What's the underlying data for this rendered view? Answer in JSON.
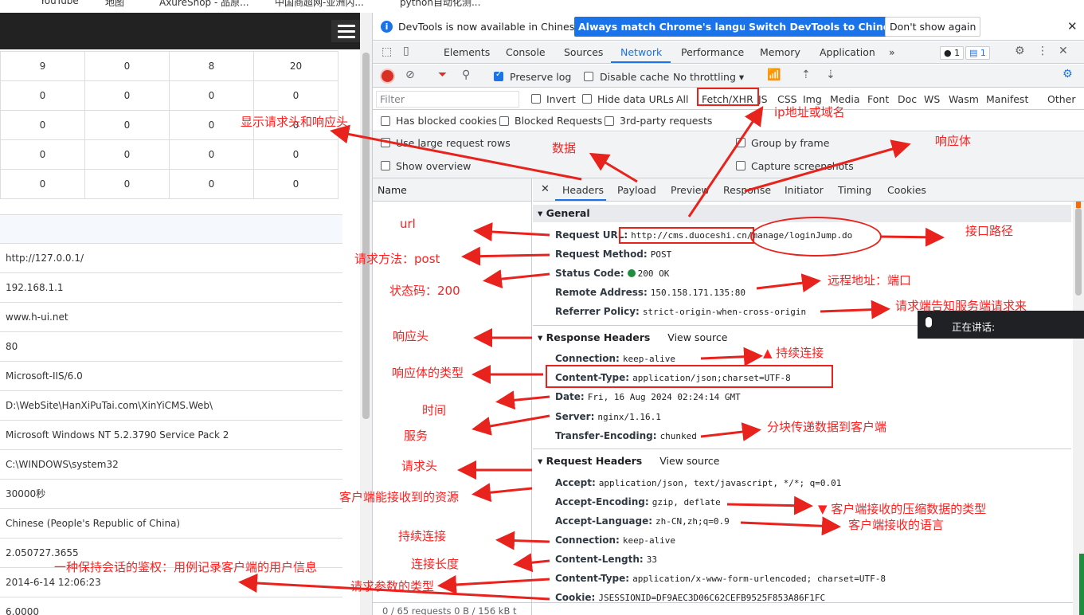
{
  "bookmarks": [
    "YouTube",
    "地图",
    "AxureShop - 品原...",
    "中国商超网-亚洲内...",
    "python自动化测..."
  ],
  "left": {
    "stats": [
      [
        "9",
        "0",
        "8",
        "20"
      ],
      [
        "0",
        "0",
        "0",
        "0"
      ],
      [
        "0",
        "0",
        "0",
        "0"
      ],
      [
        "0",
        "0",
        "0",
        "0"
      ],
      [
        "0",
        "0",
        "0",
        "0"
      ]
    ],
    "info": [
      "http://127.0.0.1/",
      "192.168.1.1",
      "www.h-ui.net",
      "80",
      "Microsoft-IIS/6.0",
      "D:\\WebSite\\HanXiPuTai.com\\XinYiCMS.Web\\",
      "Microsoft Windows NT 5.2.3790 Service Pack 2",
      "C:\\WINDOWS\\system32",
      "30000秒",
      "Chinese (People's Republic of China)",
      "2.050727.3655",
      "2014-6-14 12:06:23",
      "6.0000"
    ]
  },
  "devtools": {
    "infobar": {
      "message": "DevTools is now available in Chinese!",
      "btn_match": "Always match Chrome's language",
      "btn_switch": "Switch DevTools to Chinese",
      "btn_dont": "Don't show again"
    },
    "tabs": [
      "Elements",
      "Console",
      "Sources",
      "Network",
      "Performance",
      "Memory",
      "Application"
    ],
    "badges": {
      "errors": "1",
      "issues": "1"
    },
    "toolbar": {
      "preserve_log": "Preserve log",
      "disable_cache": "Disable cache",
      "throttling": "No throttling"
    },
    "filter": {
      "placeholder": "Filter",
      "invert": "Invert",
      "hide_data": "Hide data URLs",
      "types": [
        "All",
        "Fetch/XHR",
        "JS",
        "CSS",
        "Img",
        "Media",
        "Font",
        "Doc",
        "WS",
        "Wasm",
        "Manifest",
        "Other"
      ]
    },
    "options": {
      "blocked_cookies": "Has blocked cookies",
      "blocked_requests": "Blocked Requests",
      "third_party": "3rd-party requests"
    },
    "settings": {
      "large_rows": "Use large request rows",
      "group_frame": "Group by frame",
      "overview": "Show overview",
      "screenshots": "Capture screenshots"
    },
    "name_header": "Name",
    "footer": "0 / 65 requests   0 B / 156 kB t",
    "detail_tabs": [
      "Headers",
      "Payload",
      "Preview",
      "Response",
      "Initiator",
      "Timing",
      "Cookies"
    ],
    "general": {
      "title": "General",
      "rows": [
        {
          "k": "Request URL:",
          "v": "http://cms.duoceshi.cn/manage/loginJump.do"
        },
        {
          "k": "Request Method:",
          "v": "POST"
        },
        {
          "k": "Status Code:",
          "v": "200 OK"
        },
        {
          "k": "Remote Address:",
          "v": "150.158.171.135:80"
        },
        {
          "k": "Referrer Policy:",
          "v": "strict-origin-when-cross-origin"
        }
      ]
    },
    "response_headers": {
      "title": "Response Headers",
      "view_source": "View source",
      "rows": [
        {
          "k": "Connection:",
          "v": "keep-alive"
        },
        {
          "k": "Content-Type:",
          "v": "application/json;charset=UTF-8"
        },
        {
          "k": "Date:",
          "v": "Fri, 16 Aug 2024 02:24:14 GMT"
        },
        {
          "k": "Server:",
          "v": "nginx/1.16.1"
        },
        {
          "k": "Transfer-Encoding:",
          "v": "chunked"
        }
      ]
    },
    "request_headers": {
      "title": "Request Headers",
      "view_source": "View source",
      "rows": [
        {
          "k": "Accept:",
          "v": "application/json, text/javascript, */*; q=0.01"
        },
        {
          "k": "Accept-Encoding:",
          "v": "gzip, deflate"
        },
        {
          "k": "Accept-Language:",
          "v": "zh-CN,zh;q=0.9"
        },
        {
          "k": "Connection:",
          "v": "keep-alive"
        },
        {
          "k": "Content-Length:",
          "v": "33"
        },
        {
          "k": "Content-Type:",
          "v": "application/x-www-form-urlencoded; charset=UTF-8"
        },
        {
          "k": "Cookie:",
          "v": "JSESSIONID=DF9AEC3D06C62CEFB9525F853A86F1FC"
        }
      ]
    }
  },
  "voice": {
    "text": "正在讲话:"
  },
  "annotations": {
    "show_headers": "显示请求头和响应头",
    "data": "数据",
    "ip": "ip地址或域名",
    "response_body": "响应体",
    "url": "url",
    "path": "接口路径",
    "method": "请求方法：post",
    "status": "状态码：200",
    "remote": "远程地址：端口",
    "referrer": "请求端告知服务端请求来",
    "resp_headers": "响应头",
    "keepalive1": "▲ 持续连接",
    "body_type": "响应体的类型",
    "time": "时间",
    "service": "服务",
    "chunked": "分块传递数据到客户端",
    "req_headers": "请求头",
    "accept": "客户端能接收到的资源",
    "encoding": "▼ 客户端接收的压缩数据的类型",
    "language": "客户端接收的语言",
    "keepalive2": "持续连接",
    "length": "连接长度",
    "cookie": "一种保持会话的鉴权：用例记录客户端的用户信息",
    "param_type": "请求参数的类型"
  }
}
